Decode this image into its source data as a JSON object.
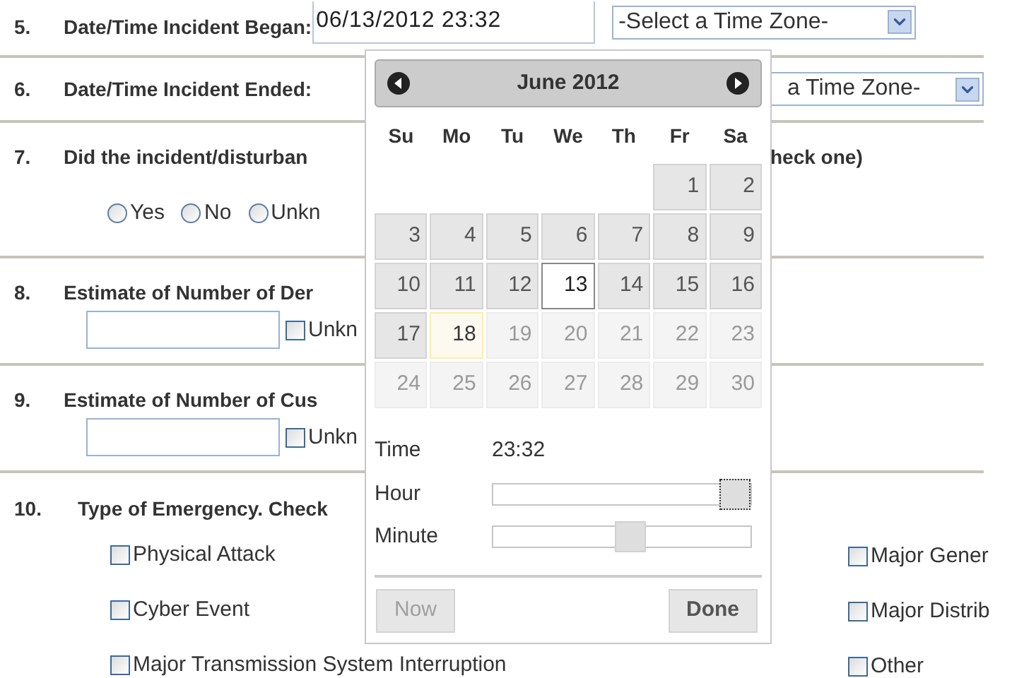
{
  "questions": [
    {
      "number": "5.",
      "label": "Date/Time Incident Began:",
      "datetime_value": "06/13/2012 23:32",
      "timezone_select": "-Select a Time Zone-"
    },
    {
      "number": "6.",
      "label": "Date/Time Incident Ended:",
      "timezone_select": "a Time Zone-"
    },
    {
      "number": "7.",
      "label": "Did the incident/disturban",
      "label_continued": "heck one)",
      "radios": [
        {
          "label": "Yes",
          "selected": false
        },
        {
          "label": "No",
          "selected": false
        },
        {
          "label": "Unkn",
          "selected": false
        }
      ]
    },
    {
      "number": "8.",
      "label": "Estimate of Number of Der",
      "unknown_checkbox": {
        "label": "Unkn",
        "checked": false
      }
    },
    {
      "number": "9.",
      "label": "Estimate of Number of Cus",
      "unknown_checkbox": {
        "label": "Unkn",
        "checked": false
      }
    },
    {
      "number": "10.",
      "label": "Type of Emergency. Check",
      "options_left": [
        {
          "label": "Physical Attack",
          "checked": false
        },
        {
          "label": "Cyber Event",
          "checked": false
        },
        {
          "label": "Major Transmission System Interruption",
          "checked": false
        }
      ],
      "options_right": [
        {
          "label": "Major Gener",
          "checked": false
        },
        {
          "label": "Major Distrib",
          "checked": false
        },
        {
          "label": "Other",
          "checked": false
        }
      ]
    }
  ],
  "datepicker": {
    "month_title": "June 2012",
    "weekdays": [
      "Su",
      "Mo",
      "Tu",
      "We",
      "Th",
      "Fr",
      "Sa"
    ],
    "weeks": [
      {
        "days": [
          {
            "kind": "blank"
          },
          {
            "kind": "blank"
          },
          {
            "kind": "blank"
          },
          {
            "kind": "blank"
          },
          {
            "kind": "blank"
          },
          {
            "kind": "day",
            "label": "1",
            "selected": false,
            "today": false,
            "disabled": false
          },
          {
            "kind": "day",
            "label": "2",
            "selected": false,
            "today": false,
            "disabled": false
          }
        ]
      },
      {
        "days": [
          {
            "kind": "day",
            "label": "3",
            "selected": false,
            "today": false,
            "disabled": false
          },
          {
            "kind": "day",
            "label": "4",
            "selected": false,
            "today": false,
            "disabled": false
          },
          {
            "kind": "day",
            "label": "5",
            "selected": false,
            "today": false,
            "disabled": false
          },
          {
            "kind": "day",
            "label": "6",
            "selected": false,
            "today": false,
            "disabled": false
          },
          {
            "kind": "day",
            "label": "7",
            "selected": false,
            "today": false,
            "disabled": false
          },
          {
            "kind": "day",
            "label": "8",
            "selected": false,
            "today": false,
            "disabled": false
          },
          {
            "kind": "day",
            "label": "9",
            "selected": false,
            "today": false,
            "disabled": false
          }
        ]
      },
      {
        "days": [
          {
            "kind": "day",
            "label": "10",
            "selected": false,
            "today": false,
            "disabled": false
          },
          {
            "kind": "day",
            "label": "11",
            "selected": false,
            "today": false,
            "disabled": false
          },
          {
            "kind": "day",
            "label": "12",
            "selected": false,
            "today": false,
            "disabled": false
          },
          {
            "kind": "day",
            "label": "13",
            "selected": true,
            "today": false,
            "disabled": false
          },
          {
            "kind": "day",
            "label": "14",
            "selected": false,
            "today": false,
            "disabled": false
          },
          {
            "kind": "day",
            "label": "15",
            "selected": false,
            "today": false,
            "disabled": false
          },
          {
            "kind": "day",
            "label": "16",
            "selected": false,
            "today": false,
            "disabled": false
          }
        ]
      },
      {
        "days": [
          {
            "kind": "day",
            "label": "17",
            "selected": false,
            "today": false,
            "disabled": false
          },
          {
            "kind": "day",
            "label": "18",
            "selected": false,
            "today": true,
            "disabled": false
          },
          {
            "kind": "day",
            "label": "19",
            "selected": false,
            "today": false,
            "disabled": true
          },
          {
            "kind": "day",
            "label": "20",
            "selected": false,
            "today": false,
            "disabled": true
          },
          {
            "kind": "day",
            "label": "21",
            "selected": false,
            "today": false,
            "disabled": true
          },
          {
            "kind": "day",
            "label": "22",
            "selected": false,
            "today": false,
            "disabled": true
          },
          {
            "kind": "day",
            "label": "23",
            "selected": false,
            "today": false,
            "disabled": true
          }
        ]
      },
      {
        "days": [
          {
            "kind": "day",
            "label": "24",
            "selected": false,
            "today": false,
            "disabled": true
          },
          {
            "kind": "day",
            "label": "25",
            "selected": false,
            "today": false,
            "disabled": true
          },
          {
            "kind": "day",
            "label": "26",
            "selected": false,
            "today": false,
            "disabled": true
          },
          {
            "kind": "day",
            "label": "27",
            "selected": false,
            "today": false,
            "disabled": true
          },
          {
            "kind": "day",
            "label": "28",
            "selected": false,
            "today": false,
            "disabled": true
          },
          {
            "kind": "day",
            "label": "29",
            "selected": false,
            "today": false,
            "disabled": true
          },
          {
            "kind": "day",
            "label": "30",
            "selected": false,
            "today": false,
            "disabled": true
          }
        ]
      }
    ],
    "time_label": "Time",
    "time_value": "23:32",
    "sliders": [
      {
        "label": "Hour",
        "level": 1.0,
        "focused": true
      },
      {
        "label": "Minute",
        "level": 0.54,
        "focused": false
      }
    ],
    "buttons": [
      {
        "label": "Now",
        "disabled": true
      },
      {
        "label": "Done",
        "disabled": false
      }
    ]
  }
}
